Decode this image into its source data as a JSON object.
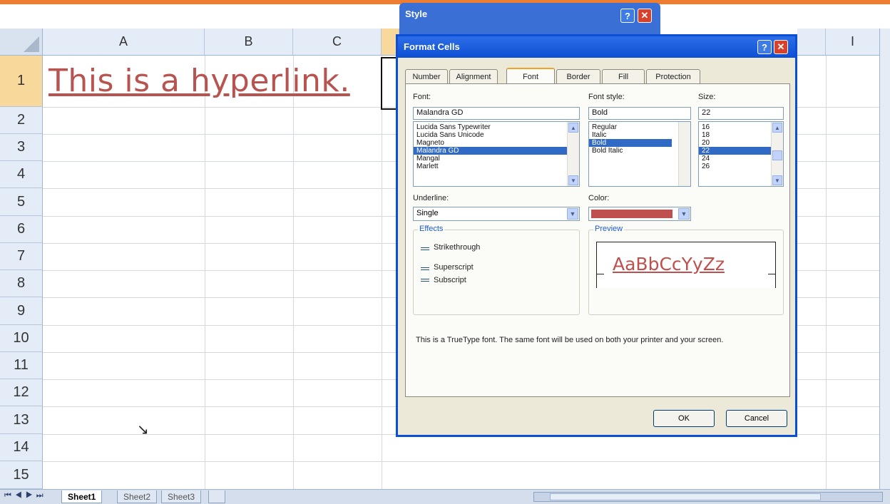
{
  "columns": [
    "A",
    "B",
    "C"
  ],
  "rows": [
    "1",
    "2",
    "3",
    "4",
    "5",
    "6",
    "7",
    "8",
    "9",
    "10",
    "11",
    "12",
    "13",
    "14",
    "15"
  ],
  "partial_col_label": "I",
  "cell_A1": "This is a hyperlink.",
  "sheet_tabs": [
    "Sheet1",
    "Sheet2",
    "Sheet3"
  ],
  "nav_buttons": "⏮ ◀ ▶ ⏭",
  "style_dialog": {
    "title": "Style"
  },
  "format_cells": {
    "title": "Format Cells",
    "help": "?",
    "close": "✕",
    "tabs": [
      "Number",
      "Alignment",
      "Font",
      "Border",
      "Fill",
      "Protection"
    ],
    "font_label": "Font:",
    "font_value": "Malandra GD",
    "font_list": [
      "Lucida Sans Typewriter",
      "Lucida Sans Unicode",
      "Magneto",
      "Malandra GD",
      "Mangal",
      "Marlett"
    ],
    "style_label": "Font style:",
    "style_value": "Bold",
    "style_list": [
      "Regular",
      "Italic",
      "Bold",
      "Bold Italic"
    ],
    "size_label": "Size:",
    "size_value": "22",
    "size_list": [
      "16",
      "18",
      "20",
      "22",
      "24",
      "26"
    ],
    "underline_label": "Underline:",
    "underline_value": "Single",
    "color_label": "Color:",
    "color_hex": "#c0504d",
    "effects_label": "Effects",
    "effects": [
      "Strikethrough",
      "Superscript",
      "Subscript"
    ],
    "preview_label": "Preview",
    "preview_text": "AaBbCcYyZz",
    "description": "This is a TrueType font.  The same font will be used on both your printer and your screen.",
    "ok": "OK",
    "cancel": "Cancel"
  },
  "colors": {
    "accent": "#ed7d31",
    "hyperlink": "#b85450",
    "title_blue": "#0a4fd6"
  }
}
